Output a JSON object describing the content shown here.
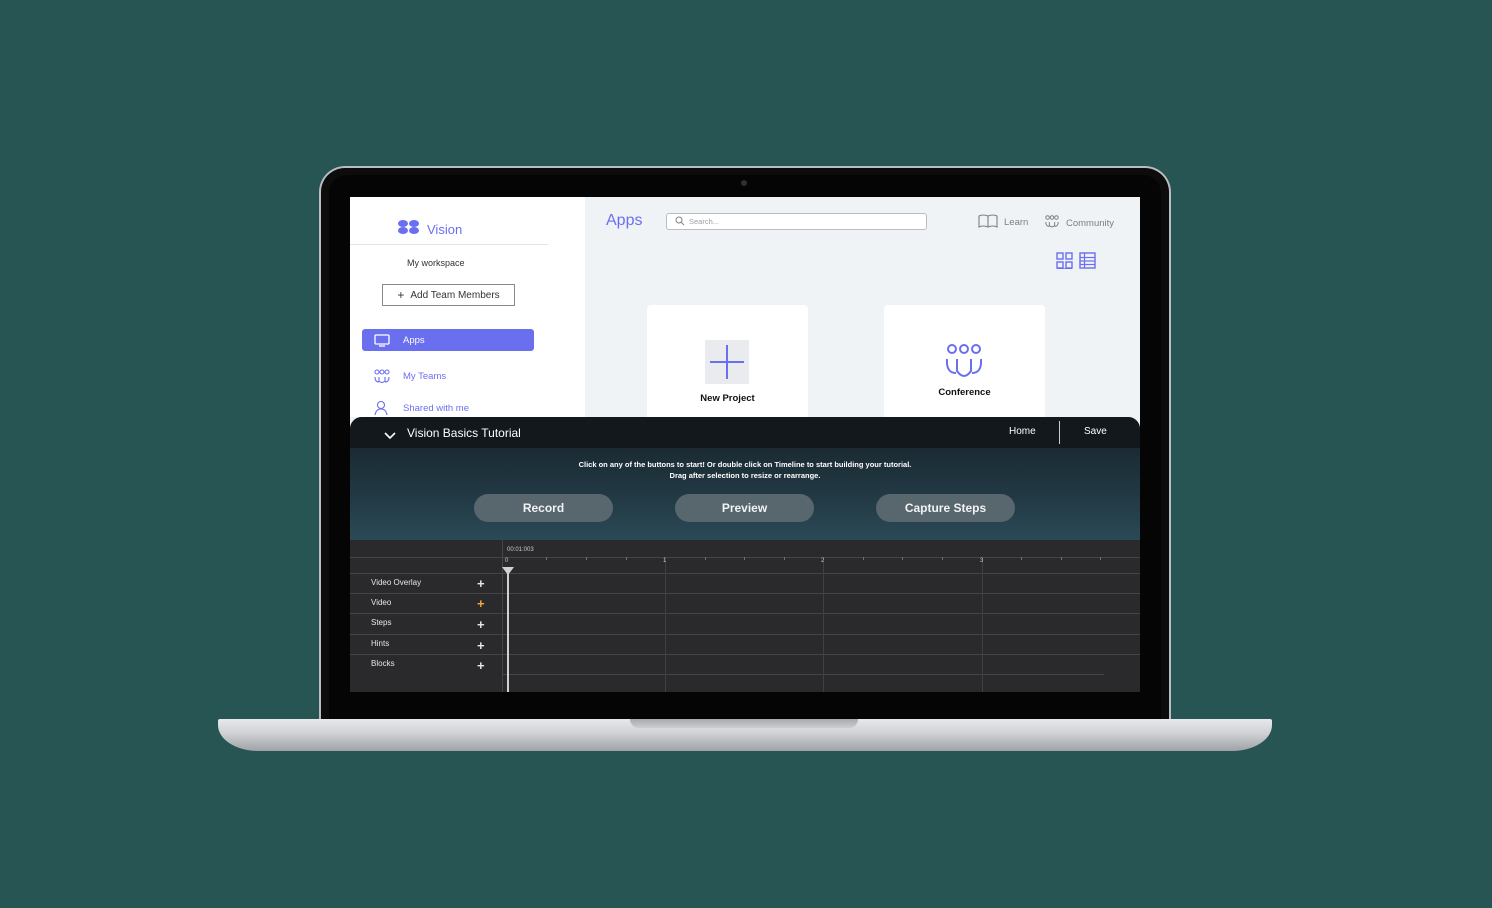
{
  "sidebar": {
    "brand": "Vision",
    "workspace": "My workspace",
    "add_team_label": "Add Team Members",
    "items": [
      {
        "label": "Apps",
        "icon": "monitor-icon"
      },
      {
        "label": "My Teams",
        "icon": "team-icon"
      },
      {
        "label": "Shared with me",
        "icon": "shared-user-icon"
      }
    ]
  },
  "header": {
    "title": "Apps",
    "search_placeholder": "Search...",
    "learn_label": "Learn",
    "community_label": "Community"
  },
  "cards": [
    {
      "label": "New Project",
      "icon": "plus-icon"
    },
    {
      "label": "Conference",
      "icon": "team-icon"
    }
  ],
  "panel": {
    "title": "Vision Basics Tutorial",
    "home_label": "Home",
    "save_label": "Save",
    "hint_line1": "Click on any of the buttons to start! Or double click on Timeline to start building your tutorial.",
    "hint_line2": "Drag after selection to resize or rearrange.",
    "buttons": {
      "record": "Record",
      "preview": "Preview",
      "capture": "Capture Steps"
    }
  },
  "timeline": {
    "timecode": "00:01:003",
    "ruler_labels": [
      "0",
      "1",
      "2",
      "3"
    ],
    "tracks": [
      {
        "label": "Video Overlay",
        "plus_color": "#e6e7e9"
      },
      {
        "label": "Video",
        "plus_color": "#f0a93a"
      },
      {
        "label": "Steps",
        "plus_color": "#e6e7e9"
      },
      {
        "label": "Hints",
        "plus_color": "#e6e7e9"
      },
      {
        "label": "Blocks",
        "plus_color": "#e6e7e9"
      }
    ]
  },
  "colors": {
    "accent": "#6a6ff0",
    "background": "#275553",
    "highlight": "#f0a93a"
  }
}
